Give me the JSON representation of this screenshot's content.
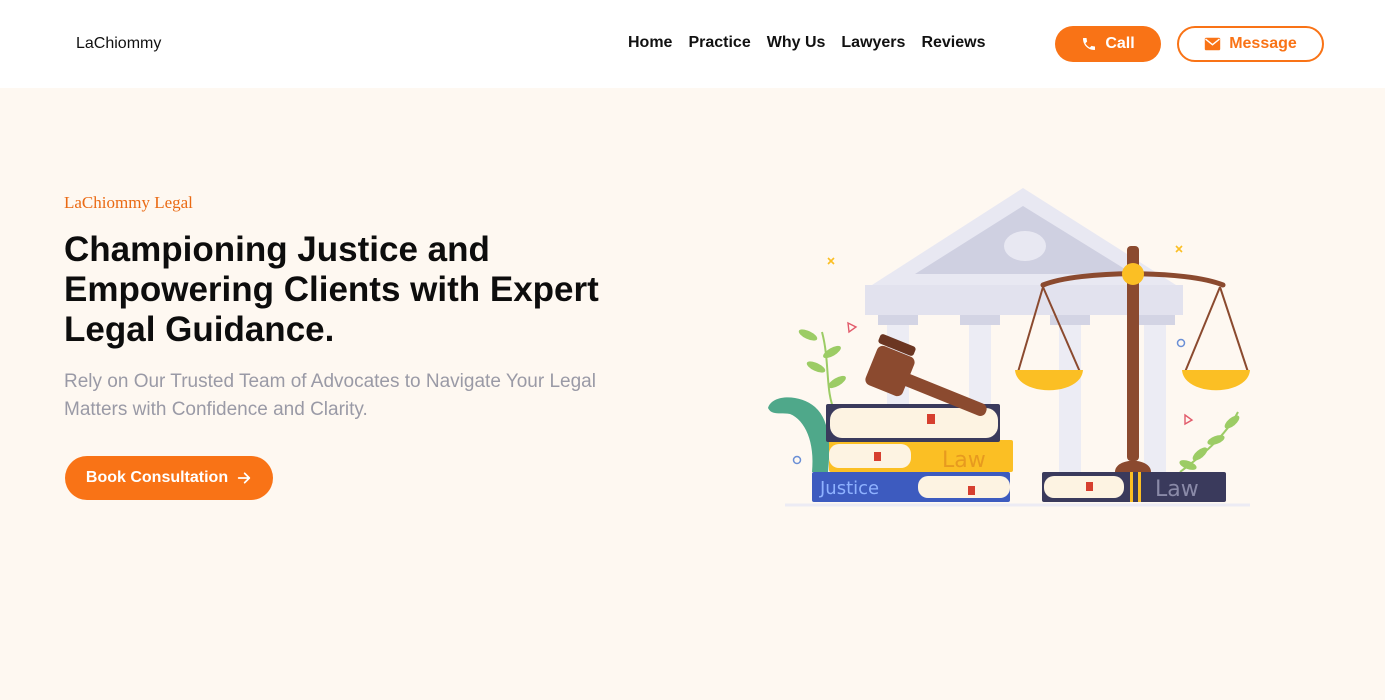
{
  "nav": {
    "brand": "LaChiommy",
    "links": [
      "Home",
      "Practice",
      "Why Us",
      "Lawyers",
      "Reviews"
    ],
    "call_label": "Call",
    "message_label": "Message"
  },
  "hero": {
    "eyebrow": "LaChiommy Legal",
    "headline_lines": [
      "Championing Justice and",
      "Empowering Clients with Expert",
      "Legal Guidance."
    ],
    "subtitle_lines": [
      "Rely on Our Trusted Team of Advocates to Navigate Your Legal",
      "Matters with Confidence and Clarity."
    ],
    "cta_label": "Book Consultation",
    "illustration": {
      "book_labels": [
        "Law",
        "Justice",
        "Law"
      ]
    }
  },
  "colors": {
    "accent": "#f97316",
    "hero_bg": "#fef8f1",
    "subtitle": "#9a9aa6"
  },
  "icons": {
    "call": "phone-icon",
    "message": "envelope-icon",
    "cta": "arrow-right-icon"
  }
}
